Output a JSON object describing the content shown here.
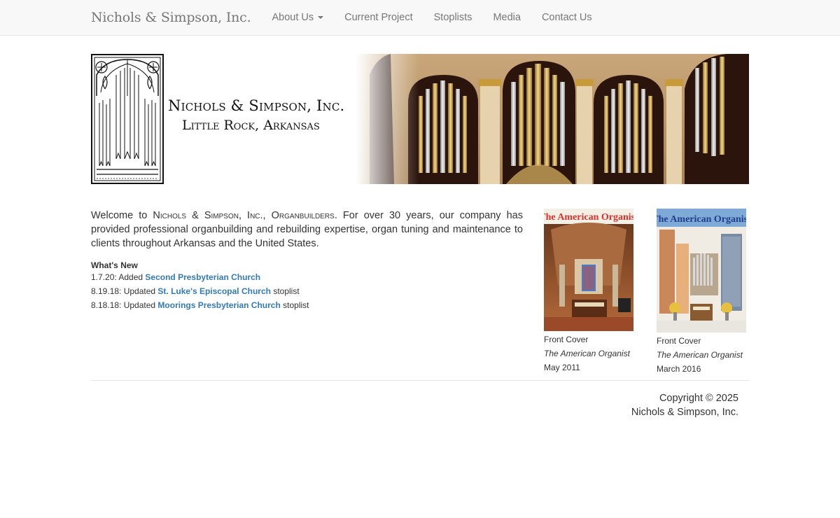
{
  "nav": {
    "brand": "Nichols & Simpson, Inc.",
    "items": [
      {
        "label": "About Us",
        "dropdown": true
      },
      {
        "label": "Current Project"
      },
      {
        "label": "Stoplists"
      },
      {
        "label": "Media"
      },
      {
        "label": "Contact Us"
      }
    ]
  },
  "banner": {
    "line1": "Nichols & Simpson, Inc.",
    "line2": "Little Rock, Arkansas"
  },
  "welcome": {
    "prefix": "Welcome to ",
    "company": "Nichols & Simpson, Inc., Organbuilders",
    "suffix": ". For over 30 years, our company has provided professional organbuilding and rebuilding expertise, organ tuning and maintenance to clients throughout Arkansas and the United States."
  },
  "whats_new": {
    "heading": "What's New",
    "items": [
      {
        "prefix": "1.7.20: Added ",
        "link": "Second Presbyterian Church",
        "suffix": ""
      },
      {
        "prefix": "8.19.18: Updated ",
        "link": "St. Luke's Episcopal Church",
        "suffix": " stoplist"
      },
      {
        "prefix": "8.18.18: Updated ",
        "link": "Moorings Presbyterian Church",
        "suffix": " stoplist"
      }
    ]
  },
  "covers": [
    {
      "title_art": "The American Organist",
      "line1": "Front Cover",
      "line2": "The American Organist",
      "line3": "May 2011"
    },
    {
      "title_art": "The American Organist",
      "line1": "Front Cover",
      "line2": "The American Organist",
      "line3": "March 2016"
    }
  ],
  "footer": {
    "line1": "Copyright © 2025",
    "line2": "Nichols & Simpson, Inc."
  },
  "colors": {
    "link": "#337ab7",
    "navbar_bg": "#f8f8f8",
    "cover1_title": "#e0302a",
    "cover2_title": "#1f3f8c"
  }
}
